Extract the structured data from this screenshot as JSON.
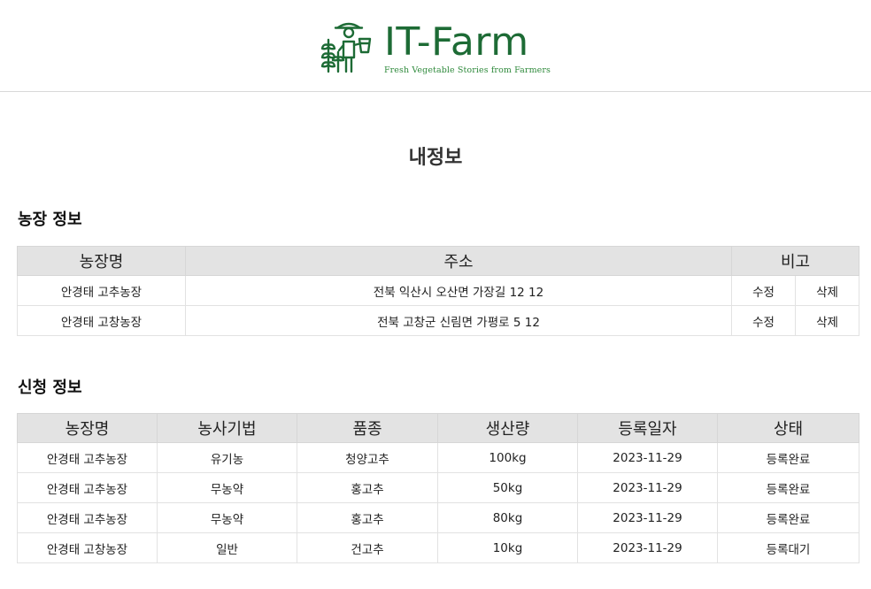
{
  "header": {
    "brand": "IT-Farm",
    "tagline": "Fresh Vegetable Stories from Farmers",
    "logo_icon": "farmer-with-plants-icon",
    "brand_color": "#1d6b35"
  },
  "page_title": "내정보",
  "farm_section": {
    "title": "농장 정보",
    "headers": {
      "name": "농장명",
      "address": "주소",
      "note": "비고"
    },
    "rows": [
      {
        "name": "안경태 고추농장",
        "address": "전북 익산시 오산면 가장길 12 12",
        "edit": "수정",
        "delete": "삭제"
      },
      {
        "name": "안경태 고창농장",
        "address": "전북 고창군 신림면 가평로 5 12",
        "edit": "수정",
        "delete": "삭제"
      }
    ]
  },
  "apply_section": {
    "title": "신청 정보",
    "headers": {
      "farm": "농장명",
      "method": "농사기법",
      "variety": "품종",
      "amount": "생산량",
      "date": "등록일자",
      "status": "상태"
    },
    "rows": [
      {
        "farm": "안경태 고추농장",
        "method": "유기농",
        "variety": "청양고추",
        "amount": "100kg",
        "date": "2023-11-29",
        "status": "등록완료"
      },
      {
        "farm": "안경태 고추농장",
        "method": "무농약",
        "variety": "홍고추",
        "amount": "50kg",
        "date": "2023-11-29",
        "status": "등록완료"
      },
      {
        "farm": "안경태 고추농장",
        "method": "무농약",
        "variety": "홍고추",
        "amount": "80kg",
        "date": "2023-11-29",
        "status": "등록완료"
      },
      {
        "farm": "안경태 고창농장",
        "method": "일반",
        "variety": "건고추",
        "amount": "10kg",
        "date": "2023-11-29",
        "status": "등록대기"
      }
    ]
  }
}
